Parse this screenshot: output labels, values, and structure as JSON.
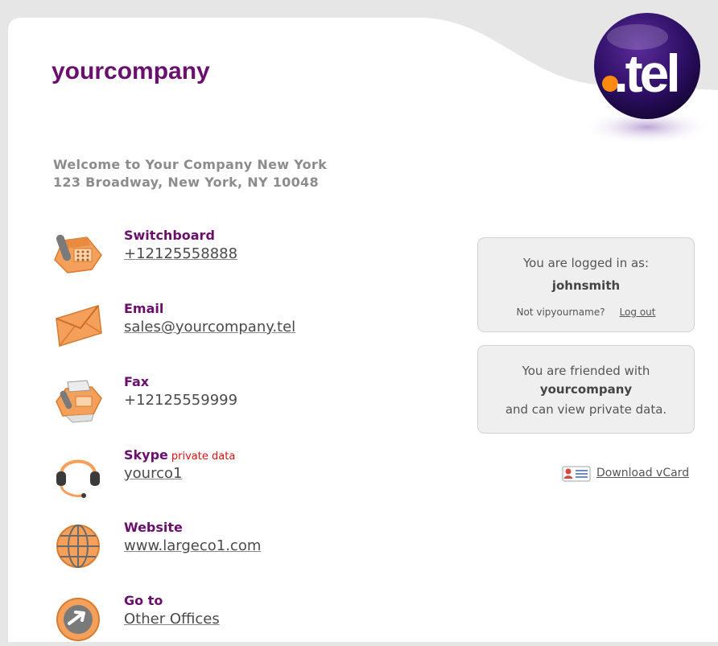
{
  "header": {
    "company_name": "yourcompany",
    "logo_text": ".tel"
  },
  "welcome": {
    "line1": "Welcome to Your Company New York",
    "line2": "123 Broadway, New York, NY 10048"
  },
  "contacts": [
    {
      "label": "Switchboard",
      "value": "+12125558888",
      "icon": "telephone-icon"
    },
    {
      "label": "Email",
      "value": "sales@yourcompany.tel",
      "icon": "envelope-icon"
    },
    {
      "label": "Fax",
      "value": "+12125559999",
      "icon": "fax-icon"
    },
    {
      "label": "Skype",
      "value": "yourco1",
      "icon": "headset-icon",
      "badge": "private data"
    },
    {
      "label": "Website",
      "value": "www.largeco1.com",
      "icon": "globe-icon"
    },
    {
      "label": "Go to",
      "value": "Other Offices",
      "icon": "arrow-right-icon"
    }
  ],
  "login": {
    "title": "You are logged in as:",
    "username": "johnsmith",
    "not_user_text": "Not vipyourname?",
    "logout_label": "Log out"
  },
  "friend": {
    "line1": "You are friended with",
    "company": "yourcompany",
    "line3": "and can view private data."
  },
  "vcard": {
    "label": "Download vCard",
    "icon": "vcard-icon"
  },
  "colors": {
    "brand_purple": "#6a0f6e",
    "accent_orange": "#f5a05a",
    "private_red": "#e01010"
  }
}
